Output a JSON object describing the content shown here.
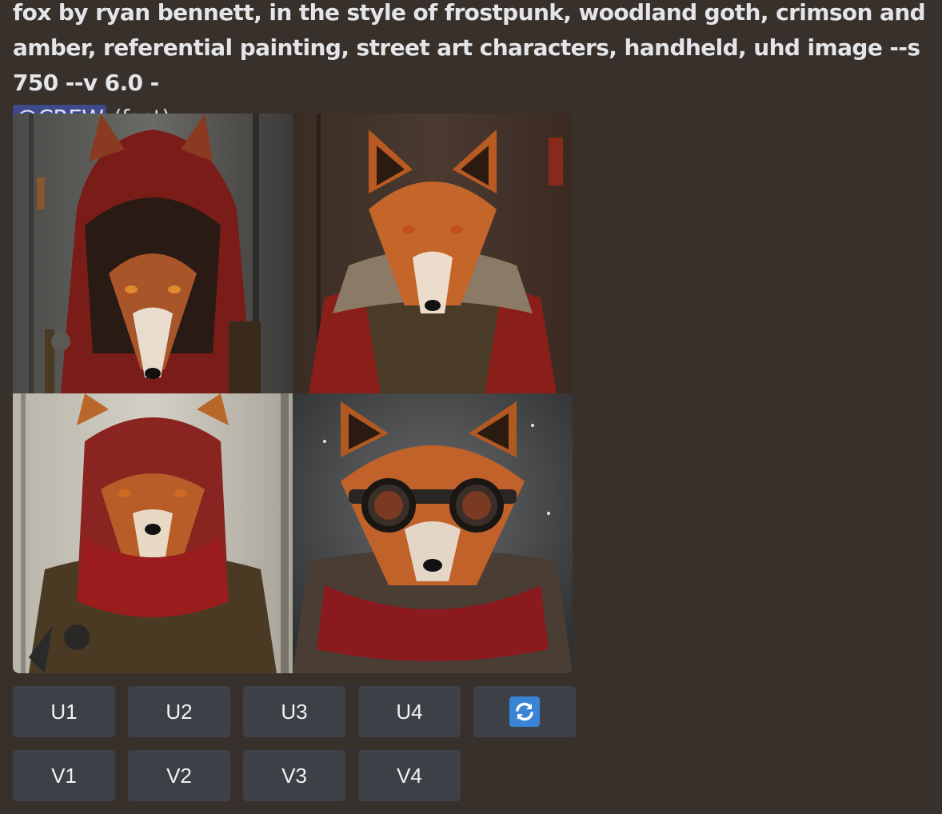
{
  "message": {
    "prompt": "fox by ryan bennett, in the style of frostpunk, woodland goth, crimson and amber, referential painting, street art characters, handheld, uhd image --s 750 --v 6.0 -",
    "mention": "@CREW",
    "speed": "(fast)"
  },
  "image_grid": {
    "tiles": [
      {
        "subject": "fox-hooded-red-coat"
      },
      {
        "subject": "fox-fur-collar-red-jacket"
      },
      {
        "subject": "fox-red-hood-scarf"
      },
      {
        "subject": "fox-goggles-red-scarf"
      }
    ]
  },
  "buttons": {
    "upscale": [
      "U1",
      "U2",
      "U3",
      "U4"
    ],
    "variation": [
      "V1",
      "V2",
      "V3",
      "V4"
    ],
    "reroll_icon": "refresh-icon"
  },
  "colors": {
    "background": "#38302a",
    "button": "#3d4046",
    "mention_bg": "#3f4a8a",
    "reroll_accent": "#3a84d6"
  }
}
